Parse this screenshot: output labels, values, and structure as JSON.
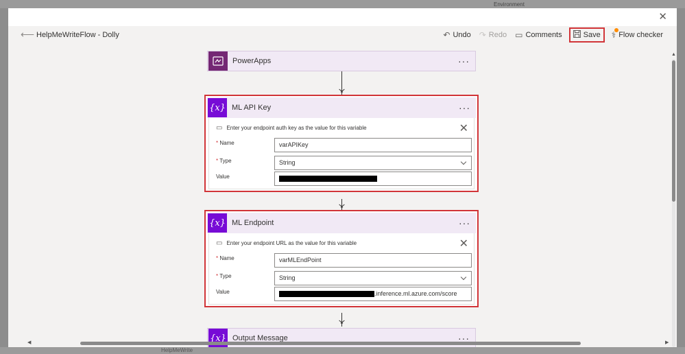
{
  "background": {
    "environment_label": "Environment",
    "bottom_item": "HelpMeWrite"
  },
  "toolbar": {
    "flow_title": "HelpMeWriteFlow - Dolly",
    "undo": "Undo",
    "redo": "Redo",
    "comments": "Comments",
    "save": "Save",
    "flow_checker": "Flow checker"
  },
  "steps": {
    "powerapps": {
      "title": "PowerApps",
      "menu": "···"
    },
    "ml_api_key": {
      "title": "ML API Key",
      "menu": "···",
      "hint": "Enter your endpoint auth key as the value for this variable",
      "name_label": "Name",
      "name_value": "varAPIKey",
      "type_label": "Type",
      "type_value": "String",
      "value_label": "Value",
      "value_text": ""
    },
    "ml_endpoint": {
      "title": "ML Endpoint",
      "menu": "···",
      "hint": "Enter your endpoint URL as the value for this variable",
      "name_label": "Name",
      "name_value": "varMLEndPoint",
      "type_label": "Type",
      "type_value": "String",
      "value_label": "Value",
      "value_text": ".inference.ml.azure.com/score"
    },
    "output_message": {
      "title": "Output Message",
      "menu": "···"
    }
  },
  "icons": {
    "variable": "{x}",
    "powerapps": "powerapps-icon",
    "close": "close-icon",
    "undo": "undo-icon",
    "redo": "redo-icon",
    "comments": "comment-icon",
    "save": "save-icon",
    "flow_checker": "stethoscope-icon"
  },
  "colors": {
    "variable_accent": "#770bd6",
    "powerapps_accent": "#742774",
    "highlight_red": "#d13438",
    "notification_dot": "#ff8c00"
  }
}
